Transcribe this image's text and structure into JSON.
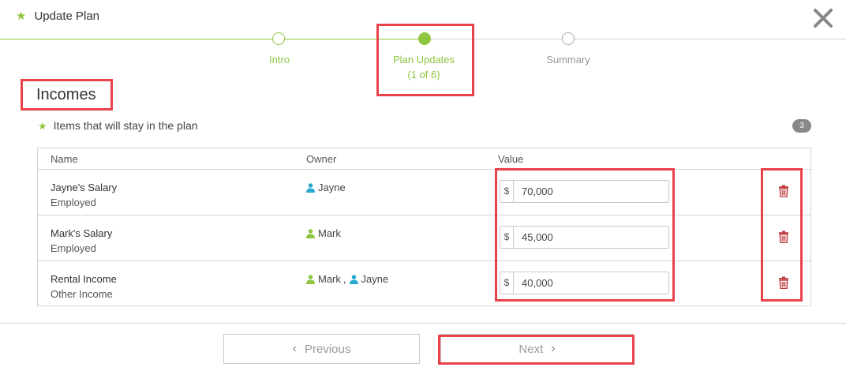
{
  "header": {
    "title": "Update Plan",
    "star_icon": "star-icon",
    "close_icon": "close-icon"
  },
  "stepper": {
    "steps": [
      {
        "label": "Intro",
        "state": "done"
      },
      {
        "label": "Plan Updates",
        "sublabel": "(1 of 6)",
        "state": "active"
      },
      {
        "label": "Summary",
        "state": "pending"
      }
    ]
  },
  "section": {
    "title": "Incomes",
    "subheader": "Items that will stay in the plan",
    "count": "3"
  },
  "table": {
    "headers": {
      "name": "Name",
      "owner": "Owner",
      "value": "Value"
    },
    "rows": [
      {
        "name": "Jayne's Salary",
        "type": "Employed",
        "owners": [
          {
            "name": "Jayne",
            "color": "#29a8d0"
          }
        ],
        "currency": "$",
        "value": "70,000"
      },
      {
        "name": "Mark's Salary",
        "type": "Employed",
        "owners": [
          {
            "name": "Mark",
            "color": "#8dc63f"
          }
        ],
        "currency": "$",
        "value": "45,000"
      },
      {
        "name": "Rental Income",
        "type": "Other Income",
        "owners": [
          {
            "name": "Mark",
            "color": "#8dc63f"
          },
          {
            "name": "Jayne",
            "color": "#29a8d0"
          }
        ],
        "owner_separator": ",",
        "currency": "$",
        "value": "40,000"
      }
    ]
  },
  "footer": {
    "previous_label": "Previous",
    "next_label": "Next"
  },
  "colors": {
    "accent": "#8dc63f",
    "delete": "#c0393b",
    "highlight": "#e8434a"
  }
}
